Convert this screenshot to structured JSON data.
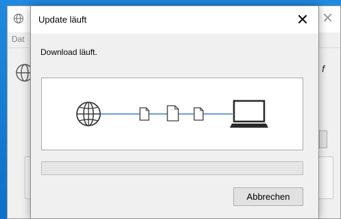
{
  "background_window": {
    "menu_partial": "Dat",
    "side_text_partial": "f",
    "close_glyph": "✕"
  },
  "dialog": {
    "title": "Update läuft",
    "close_glyph": "✕",
    "message": "Download läuft.",
    "progress_fraction": 0.0,
    "cancel_label": "Abbrechen"
  },
  "animation": {
    "icons": [
      "globe-icon",
      "document-icon",
      "document-icon",
      "document-icon",
      "monitor-icon"
    ],
    "line_color": "#3d7fd6"
  },
  "colors": {
    "progress_fill": "#06b025",
    "desktop": "#0f78d4"
  }
}
